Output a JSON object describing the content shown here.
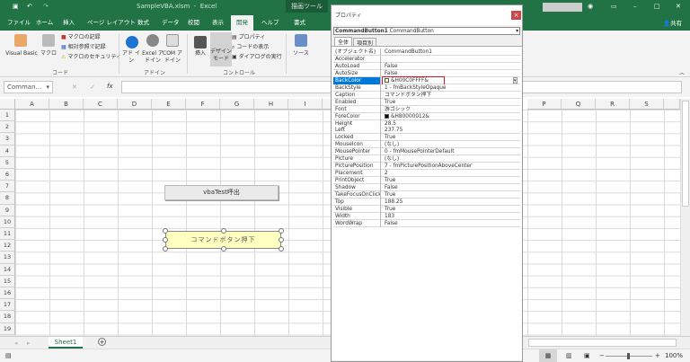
{
  "window": {
    "title": "SampleVBA.xlsm  -  Excel",
    "context_tab": "描画ツール",
    "share": "共有"
  },
  "tabs": [
    "ファイル",
    "ホーム",
    "挿入",
    "ページ レイアウト",
    "数式",
    "データ",
    "校閲",
    "表示",
    "開発",
    "ヘルプ",
    "書式"
  ],
  "ribbon": {
    "code": {
      "visual_basic": "Visual Basic",
      "macro": "マクロ",
      "record": "マクロの記録",
      "relative": "相対参照で記録",
      "security": "マクロのセキュリティ",
      "label": "コード"
    },
    "addins": {
      "addin": "アド イン",
      "excel_addin": "Excel アドイン",
      "com_addin": "COM アドイン",
      "label": "アドイン"
    },
    "controls": {
      "insert": "挿入",
      "design_mode": "デザイン モード",
      "properties": "プロパティ",
      "view_code": "コードの表示",
      "run_dialog": "ダイアログの実行",
      "label": "コントロール"
    },
    "source": {
      "source": "ソース"
    }
  },
  "formula_bar": {
    "name_box": "Comman...",
    "fx": "fx",
    "cancel": "✕",
    "enter": "✓"
  },
  "columns_left": [
    "A",
    "B",
    "C",
    "D",
    "E",
    "F",
    "G",
    "H",
    "I"
  ],
  "columns_right": [
    "P",
    "Q",
    "R",
    "S"
  ],
  "rows": [
    "1",
    "2",
    "3",
    "4",
    "5",
    "6",
    "7",
    "8",
    "9",
    "10",
    "11",
    "12",
    "13",
    "14",
    "15",
    "16",
    "17",
    "18",
    "19"
  ],
  "sheet": {
    "button1": "vbaTest呼出",
    "button2": "コマンドボタン押下",
    "tab": "Sheet1",
    "add": "+",
    "zoom": "100%"
  },
  "properties": {
    "title": "プロパティ",
    "close": "×",
    "object_name": "CommandButton1",
    "object_type": "CommandButton",
    "tab_all": "全体",
    "tab_category": "項目別",
    "rows": [
      {
        "name": "(オブジェクト名)",
        "value": "CommandButton1"
      },
      {
        "name": "Accelerator",
        "value": ""
      },
      {
        "name": "AutoLoad",
        "value": "False"
      },
      {
        "name": "AutoSize",
        "value": "False"
      },
      {
        "name": "BackColor",
        "value": "&H00C0FFFF&"
      },
      {
        "name": "BackStyle",
        "value": "1 - fmBackStyleOpaque"
      },
      {
        "name": "Caption",
        "value": "コマンドボタン押下"
      },
      {
        "name": "Enabled",
        "value": "True"
      },
      {
        "name": "Font",
        "value": "游ゴシック"
      },
      {
        "name": "ForeColor",
        "value": "&H80000012&"
      },
      {
        "name": "Height",
        "value": "28.5"
      },
      {
        "name": "Left",
        "value": "237.75"
      },
      {
        "name": "Locked",
        "value": "True"
      },
      {
        "name": "MouseIcon",
        "value": "(なし)"
      },
      {
        "name": "MousePointer",
        "value": "0 - fmMousePointerDefault"
      },
      {
        "name": "Picture",
        "value": "(なし)"
      },
      {
        "name": "PicturePosition",
        "value": "7 - fmPicturePositionAboveCenter"
      },
      {
        "name": "Placement",
        "value": "2"
      },
      {
        "name": "PrintObject",
        "value": "True"
      },
      {
        "name": "Shadow",
        "value": "False"
      },
      {
        "name": "TakeFocusOnClick",
        "value": "True"
      },
      {
        "name": "Top",
        "value": "188.25"
      },
      {
        "name": "Visible",
        "value": "True"
      },
      {
        "name": "Width",
        "value": "183"
      },
      {
        "name": "WordWrap",
        "value": "False"
      }
    ]
  },
  "colors": {
    "excel_green": "#217346",
    "button_yellow": "#ffffc0",
    "highlight": "#e81123"
  }
}
